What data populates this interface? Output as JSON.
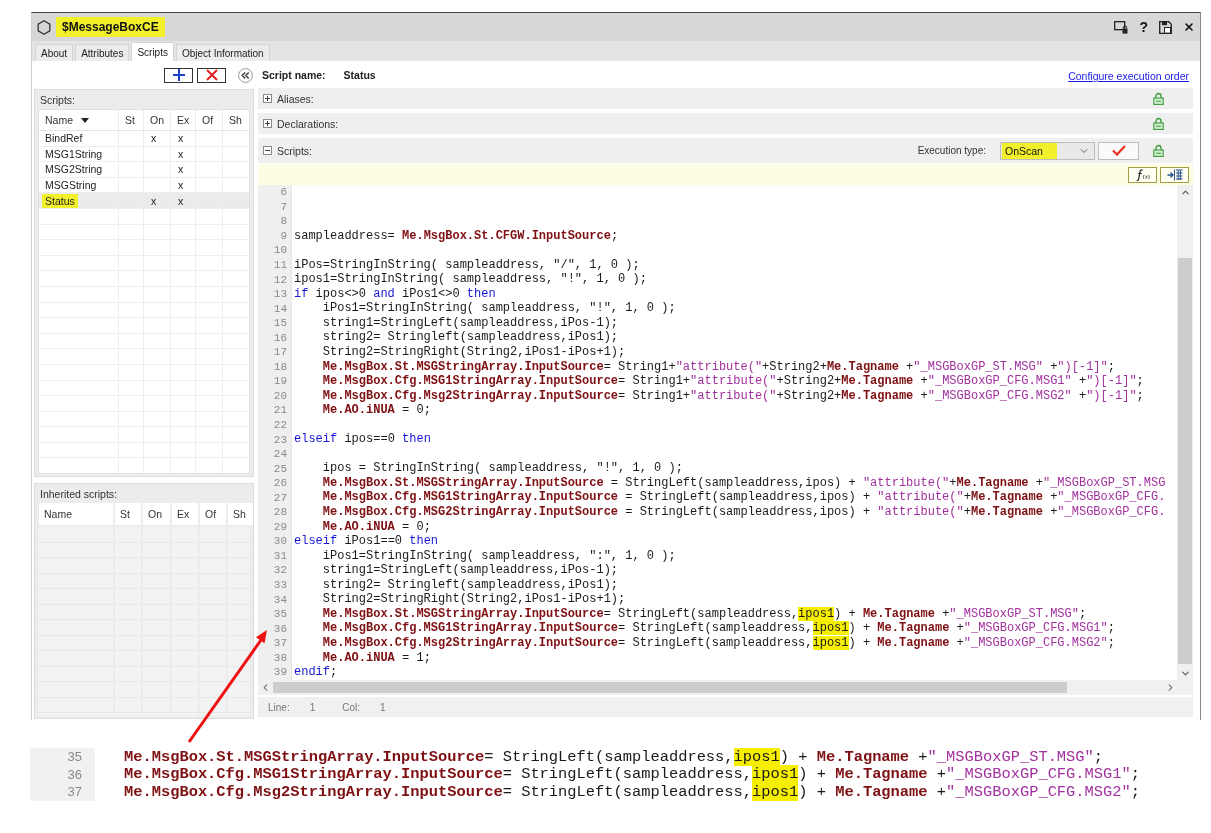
{
  "window": {
    "title": "$MessageBoxCE",
    "title_highlighted": true,
    "help": "?"
  },
  "tabs": [
    {
      "label": "About",
      "selected": false
    },
    {
      "label": "Attributes",
      "selected": false
    },
    {
      "label": "Scripts",
      "selected": true
    },
    {
      "label": "Object Information",
      "selected": false
    }
  ],
  "scripts_panel": {
    "title": "Scripts:",
    "columns": [
      {
        "label": "Name",
        "sorted": true
      },
      {
        "label": "St",
        "sorted": false
      },
      {
        "label": "On",
        "sorted": false
      },
      {
        "label": "Ex",
        "sorted": false
      },
      {
        "label": "Of",
        "sorted": false
      },
      {
        "label": "Sh",
        "sorted": false
      }
    ],
    "rows": [
      {
        "name": "BindRef",
        "on": "x",
        "ex": "x",
        "selected": false,
        "highlighted": false
      },
      {
        "name": "MSG1String",
        "ex": "x",
        "selected": false,
        "highlighted": false
      },
      {
        "name": "MSG2String",
        "ex": "x",
        "selected": false,
        "highlighted": false
      },
      {
        "name": "MSGString",
        "ex": "x",
        "selected": false,
        "highlighted": false
      },
      {
        "name": "Status",
        "on": "x",
        "ex": "x",
        "selected": true,
        "highlighted": true
      }
    ]
  },
  "inherited_panel": {
    "title": "Inherited scripts:",
    "columns": [
      "Name",
      "St",
      "On",
      "Ex",
      "Of",
      "Sh"
    ]
  },
  "script_header": {
    "label": "Script name:",
    "value": "Status",
    "link": "Configure execution order"
  },
  "sections": [
    {
      "label": "Aliases:",
      "expanded": false
    },
    {
      "label": "Declarations:",
      "expanded": false
    },
    {
      "label": "Scripts:",
      "expanded": true,
      "execution_type_label": "Execution type:",
      "execution_type": "OnScan",
      "execution_type_highlighted": true
    }
  ],
  "editor": {
    "lines": [
      {
        "number": "6"
      },
      {
        "number": "7"
      },
      {
        "number": "8"
      },
      {
        "number": "9",
        "tokens": [
          {
            "kind": "plain",
            "text": "sampleaddress= "
          },
          {
            "kind": "reference",
            "text": "Me.MsgBox.St.CFGW.InputSource"
          },
          {
            "kind": "plain",
            "text": ";"
          }
        ]
      },
      {
        "number": "10"
      },
      {
        "number": "11",
        "tokens": [
          {
            "kind": "plain",
            "text": "iPos=StringInString( sampleaddress, \"/\", 1, 0 );"
          }
        ]
      },
      {
        "number": "12",
        "tokens": [
          {
            "kind": "plain",
            "text": "ipos1=StringInString( sampleaddress, \"!\", 1, 0 );"
          }
        ]
      },
      {
        "number": "13",
        "tokens": [
          {
            "kind": "keyword",
            "text": "if"
          },
          {
            "kind": "plain",
            "text": " ipos<>0 "
          },
          {
            "kind": "keyword",
            "text": "and"
          },
          {
            "kind": "plain",
            "text": " iPos1<>0 "
          },
          {
            "kind": "keyword",
            "text": "then"
          }
        ]
      },
      {
        "number": "14",
        "tokens": [
          {
            "kind": "plain",
            "text": "    iPos1=StringInString( sampleaddress, \"!\", 1, 0 );"
          }
        ]
      },
      {
        "number": "15",
        "tokens": [
          {
            "kind": "plain",
            "text": "    string1=StringLeft(sampleaddress,iPos-1);"
          }
        ]
      },
      {
        "number": "16",
        "tokens": [
          {
            "kind": "plain",
            "text": "    string2= Stringleft(sampleaddress,iPos1);"
          }
        ]
      },
      {
        "number": "17",
        "tokens": [
          {
            "kind": "plain",
            "text": "    String2=StringRight(String2,iPos1-iPos+1);"
          }
        ]
      },
      {
        "number": "18",
        "tokens": [
          {
            "kind": "reference",
            "text": "    Me.MsgBox.St.MSGStringArray.InputSource"
          },
          {
            "kind": "plain",
            "text": "= String1+"
          },
          {
            "kind": "string",
            "text": "\"attribute(\""
          },
          {
            "kind": "plain",
            "text": "+String2+"
          },
          {
            "kind": "reference",
            "text": "Me.Tagname"
          },
          {
            "kind": "plain",
            "text": " +"
          },
          {
            "kind": "string",
            "text": "\"_MSGBoxGP_ST.MSG\""
          },
          {
            "kind": "plain",
            "text": " +"
          },
          {
            "kind": "string",
            "text": "\")[-1]\""
          },
          {
            "kind": "plain",
            "text": ";"
          }
        ]
      },
      {
        "number": "19",
        "tokens": [
          {
            "kind": "reference",
            "text": "    Me.MsgBox.Cfg.MSG1StringArray.InputSource"
          },
          {
            "kind": "plain",
            "text": "= String1+"
          },
          {
            "kind": "string",
            "text": "\"attribute(\""
          },
          {
            "kind": "plain",
            "text": "+String2+"
          },
          {
            "kind": "reference",
            "text": "Me.Tagname"
          },
          {
            "kind": "plain",
            "text": " +"
          },
          {
            "kind": "string",
            "text": "\"_MSGBoxGP_CFG.MSG1\""
          },
          {
            "kind": "plain",
            "text": " +"
          },
          {
            "kind": "string",
            "text": "\")[-1]\""
          },
          {
            "kind": "plain",
            "text": ";"
          }
        ]
      },
      {
        "number": "20",
        "tokens": [
          {
            "kind": "reference",
            "text": "    Me.MsgBox.Cfg.Msg2StringArray.InputSource"
          },
          {
            "kind": "plain",
            "text": "= String1+"
          },
          {
            "kind": "string",
            "text": "\"attribute(\""
          },
          {
            "kind": "plain",
            "text": "+String2+"
          },
          {
            "kind": "reference",
            "text": "Me.Tagname"
          },
          {
            "kind": "plain",
            "text": " +"
          },
          {
            "kind": "string",
            "text": "\"_MSGBoxGP_CFG.MSG2\""
          },
          {
            "kind": "plain",
            "text": " +"
          },
          {
            "kind": "string",
            "text": "\")[-1]\""
          },
          {
            "kind": "plain",
            "text": ";"
          }
        ]
      },
      {
        "number": "21",
        "tokens": [
          {
            "kind": "reference",
            "text": "    Me.AO.iNUA"
          },
          {
            "kind": "plain",
            "text": " = 0;"
          }
        ]
      },
      {
        "number": "22"
      },
      {
        "number": "23",
        "tokens": [
          {
            "kind": "keyword",
            "text": "elseif"
          },
          {
            "kind": "plain",
            "text": " ipos==0 "
          },
          {
            "kind": "keyword",
            "text": "then"
          }
        ]
      },
      {
        "number": "24"
      },
      {
        "number": "25",
        "tokens": [
          {
            "kind": "plain",
            "text": "    ipos = StringInString( sampleaddress, \"!\", 1, 0 );"
          }
        ]
      },
      {
        "number": "26",
        "tokens": [
          {
            "kind": "reference",
            "text": "    Me.MsgBox.St.MSGStringArray.InputSource"
          },
          {
            "kind": "plain",
            "text": " = StringLeft(sampleaddress,ipos) + "
          },
          {
            "kind": "string",
            "text": "\"attribute(\""
          },
          {
            "kind": "plain",
            "text": "+"
          },
          {
            "kind": "reference",
            "text": "Me.Tagname"
          },
          {
            "kind": "plain",
            "text": " +"
          },
          {
            "kind": "string",
            "text": "\"_MSGBoxGP_ST.MSG"
          }
        ]
      },
      {
        "number": "27",
        "tokens": [
          {
            "kind": "reference",
            "text": "    Me.MsgBox.Cfg.MSG1StringArray.InputSource"
          },
          {
            "kind": "plain",
            "text": " = StringLeft(sampleaddress,ipos) + "
          },
          {
            "kind": "string",
            "text": "\"attribute(\""
          },
          {
            "kind": "plain",
            "text": "+"
          },
          {
            "kind": "reference",
            "text": "Me.Tagname"
          },
          {
            "kind": "plain",
            "text": " +"
          },
          {
            "kind": "string",
            "text": "\"_MSGBoxGP_CFG."
          }
        ]
      },
      {
        "number": "28",
        "tokens": [
          {
            "kind": "reference",
            "text": "    Me.MsgBox.Cfg.MSG2StringArray.InputSource"
          },
          {
            "kind": "plain",
            "text": " = StringLeft(sampleaddress,ipos) + "
          },
          {
            "kind": "string",
            "text": "\"attribute(\""
          },
          {
            "kind": "plain",
            "text": "+"
          },
          {
            "kind": "reference",
            "text": "Me.Tagname"
          },
          {
            "kind": "plain",
            "text": " +"
          },
          {
            "kind": "string",
            "text": "\"_MSGBoxGP_CFG."
          }
        ]
      },
      {
        "number": "29",
        "tokens": [
          {
            "kind": "reference",
            "text": "    Me.AO.iNUA"
          },
          {
            "kind": "plain",
            "text": " = 0;"
          }
        ]
      },
      {
        "number": "30",
        "tokens": [
          {
            "kind": "keyword",
            "text": "elseif"
          },
          {
            "kind": "plain",
            "text": " iPos1==0 "
          },
          {
            "kind": "keyword",
            "text": "then"
          }
        ]
      },
      {
        "number": "31",
        "tokens": [
          {
            "kind": "plain",
            "text": "    iPos1=StringInString( sampleaddress, \":\", 1, 0 );"
          }
        ]
      },
      {
        "number": "32",
        "tokens": [
          {
            "kind": "plain",
            "text": "    string1=StringLeft(sampleaddress,iPos-1);"
          }
        ]
      },
      {
        "number": "33",
        "tokens": [
          {
            "kind": "plain",
            "text": "    string2= Stringleft(sampleaddress,iPos1);"
          }
        ]
      },
      {
        "number": "34",
        "tokens": [
          {
            "kind": "plain",
            "text": "    String2=StringRight(String2,iPos1-iPos+1);"
          }
        ]
      },
      {
        "number": "35",
        "tokens": [
          {
            "kind": "reference",
            "text": "    Me.MsgBox.St.MSGStringArray.InputSource"
          },
          {
            "kind": "plain",
            "text": "= StringLeft(sampleaddress,"
          },
          {
            "kind": "highlight",
            "text": "ipos1"
          },
          {
            "kind": "plain",
            "text": ") + "
          },
          {
            "kind": "reference",
            "text": "Me.Tagname"
          },
          {
            "kind": "plain",
            "text": " +"
          },
          {
            "kind": "string",
            "text": "\"_MSGBoxGP_ST.MSG\""
          },
          {
            "kind": "plain",
            "text": ";"
          }
        ]
      },
      {
        "number": "36",
        "tokens": [
          {
            "kind": "reference",
            "text": "    Me.MsgBox.Cfg.MSG1StringArray.InputSource"
          },
          {
            "kind": "plain",
            "text": "= StringLeft(sampleaddress,"
          },
          {
            "kind": "highlight",
            "text": "ipos1"
          },
          {
            "kind": "plain",
            "text": ") + "
          },
          {
            "kind": "reference",
            "text": "Me.Tagname"
          },
          {
            "kind": "plain",
            "text": " +"
          },
          {
            "kind": "string",
            "text": "\"_MSGBoxGP_CFG.MSG1\""
          },
          {
            "kind": "plain",
            "text": ";"
          }
        ]
      },
      {
        "number": "37",
        "tokens": [
          {
            "kind": "reference",
            "text": "    Me.MsgBox.Cfg.Msg2StringArray.InputSource"
          },
          {
            "kind": "plain",
            "text": "= StringLeft(sampleaddress,"
          },
          {
            "kind": "highlight",
            "text": "ipos1"
          },
          {
            "kind": "plain",
            "text": ") + "
          },
          {
            "kind": "reference",
            "text": "Me.Tagname"
          },
          {
            "kind": "plain",
            "text": " +"
          },
          {
            "kind": "string",
            "text": "\"_MSGBoxGP_CFG.MSG2\""
          },
          {
            "kind": "plain",
            "text": ";"
          }
        ]
      },
      {
        "number": "38",
        "tokens": [
          {
            "kind": "reference",
            "text": "    Me.AO.iNUA"
          },
          {
            "kind": "plain",
            "text": " = 1;"
          }
        ]
      },
      {
        "number": "39",
        "tokens": [
          {
            "kind": "keyword",
            "text": "endif"
          },
          {
            "kind": "plain",
            "text": ";"
          }
        ]
      }
    ],
    "status": {
      "line_label": "Line:",
      "line": "1",
      "col_label": "Col:",
      "col": "1"
    }
  },
  "callout": {
    "lines": [
      {
        "number": "35",
        "tokens": [
          {
            "kind": "reference",
            "text": "Me.MsgBox.St.MSGStringArray.InputSource"
          },
          {
            "kind": "plain",
            "text": "= StringLeft(sampleaddress,"
          },
          {
            "kind": "highlight",
            "text": "ipos1"
          },
          {
            "kind": "plain",
            "text": ") + "
          },
          {
            "kind": "reference",
            "text": "Me.Tagname"
          },
          {
            "kind": "plain",
            "text": " +"
          },
          {
            "kind": "string",
            "text": "\"_MSGBoxGP_ST.MSG\""
          },
          {
            "kind": "plain",
            "text": ";"
          }
        ]
      },
      {
        "number": "36",
        "tokens": [
          {
            "kind": "reference",
            "text": "Me.MsgBox.Cfg.MSG1StringArray.InputSource"
          },
          {
            "kind": "plain",
            "text": "= StringLeft(sampleaddress,"
          },
          {
            "kind": "highlight",
            "text": "ipos1"
          },
          {
            "kind": "plain",
            "text": ") + "
          },
          {
            "kind": "reference",
            "text": "Me.Tagname"
          },
          {
            "kind": "plain",
            "text": " +"
          },
          {
            "kind": "string",
            "text": "\"_MSGBoxGP_CFG.MSG1\""
          },
          {
            "kind": "plain",
            "text": ";"
          }
        ]
      },
      {
        "number": "37",
        "tokens": [
          {
            "kind": "reference",
            "text": "Me.MsgBox.Cfg.Msg2StringArray.InputSource"
          },
          {
            "kind": "plain",
            "text": "= StringLeft(sampleaddress,"
          },
          {
            "kind": "highlight",
            "text": "ipos1"
          },
          {
            "kind": "plain",
            "text": ") + "
          },
          {
            "kind": "reference",
            "text": "Me.Tagname"
          },
          {
            "kind": "plain",
            "text": " +"
          },
          {
            "kind": "string",
            "text": "\"_MSGBoxGP_CFG.MSG2\""
          },
          {
            "kind": "plain",
            "text": ";"
          }
        ]
      }
    ]
  }
}
